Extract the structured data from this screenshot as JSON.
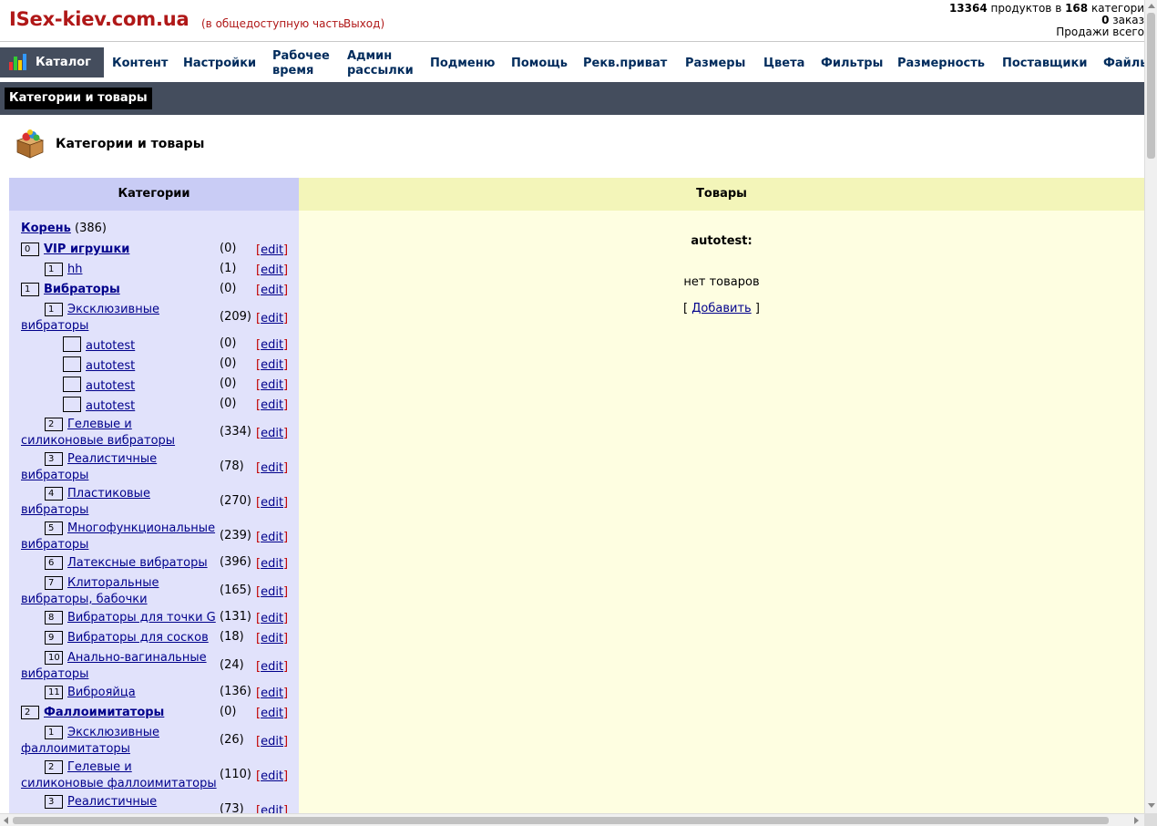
{
  "header": {
    "site_title": "ISex-kiev.com.ua",
    "public_link": "(в общедоступную часть",
    "logout_link": "Выход)",
    "stats": {
      "products_count": "13364",
      "products_text": " продуктов в ",
      "categories_count": "168",
      "categories_text": " категори",
      "orders_count": "0",
      "orders_text": " заказ",
      "sales_text": "Продажи всего"
    }
  },
  "menu": {
    "active": "Каталог",
    "items": [
      "Контент",
      "Настройки",
      "Рабочее время",
      "Админ рассылки",
      "Подменю",
      "Помощь",
      "Рекв.приват",
      "Размеры",
      "Цвета",
      "Фильтры",
      "Размерность",
      "Поставщики",
      "Файлы"
    ]
  },
  "subnav": {
    "tab": "Категории и товары"
  },
  "page": {
    "title": "Категории и товары"
  },
  "categories": {
    "header": "Категории",
    "root_label": "Корень",
    "root_count": "(386)",
    "edit_label": "edit",
    "rows": [
      {
        "num": "0",
        "name": "VIP игрушки",
        "count": "(0)"
      },
      {
        "num": "1",
        "name": "hh",
        "count": "(1)"
      },
      {
        "num": "1",
        "name": "Вибраторы",
        "count": "(0)"
      },
      {
        "num": "1",
        "name": "Эксклюзивные вибраторы",
        "count": "(209)"
      },
      {
        "num": "",
        "name": "autotest",
        "count": "(0)"
      },
      {
        "num": "",
        "name": "autotest",
        "count": "(0)"
      },
      {
        "num": "",
        "name": "autotest",
        "count": "(0)"
      },
      {
        "num": "",
        "name": "autotest",
        "count": "(0)"
      },
      {
        "num": "2",
        "name": "Гелевые и силиконовые вибраторы",
        "count": "(334)"
      },
      {
        "num": "3",
        "name": "Реалистичные вибраторы",
        "count": "(78)"
      },
      {
        "num": "4",
        "name": "Пластиковые вибраторы",
        "count": "(270)"
      },
      {
        "num": "5",
        "name": "Многофункциональные вибраторы",
        "count": "(239)"
      },
      {
        "num": "6",
        "name": "Латексные вибраторы",
        "count": "(396)"
      },
      {
        "num": "7",
        "name": "Клиторальные вибраторы, бабочки",
        "count": "(165)"
      },
      {
        "num": "8",
        "name": "Вибраторы для точки G",
        "count": "(131)"
      },
      {
        "num": "9",
        "name": "Вибраторы для сосков",
        "count": "(18)"
      },
      {
        "num": "10",
        "name": "Анально-вагинальные вибраторы",
        "count": "(24)"
      },
      {
        "num": "11",
        "name": "Виброяйца",
        "count": "(136)"
      },
      {
        "num": "2",
        "name": "Фаллоимитаторы",
        "count": "(0)"
      },
      {
        "num": "1",
        "name": "Эксклюзивные фаллоимитаторы",
        "count": "(26)"
      },
      {
        "num": "2",
        "name": "Гелевые и силиконовые фаллоимитаторы",
        "count": "(110)"
      },
      {
        "num": "3",
        "name": "Реалистичные",
        "count": "(73)"
      }
    ]
  },
  "products": {
    "header": "Товары",
    "category_title": "autotest:",
    "empty_text": "нет товаров",
    "add_open": "[ ",
    "add_label": "Добавить",
    "add_close": " ]"
  },
  "colors": {
    "brand_red": "#b01818",
    "nav_dark": "#444d5d",
    "categories_bg": "#e1e2fb",
    "categories_header_bg": "#c9ccf5",
    "products_bg": "#fefee1",
    "products_header_bg": "#f3f5b9"
  }
}
